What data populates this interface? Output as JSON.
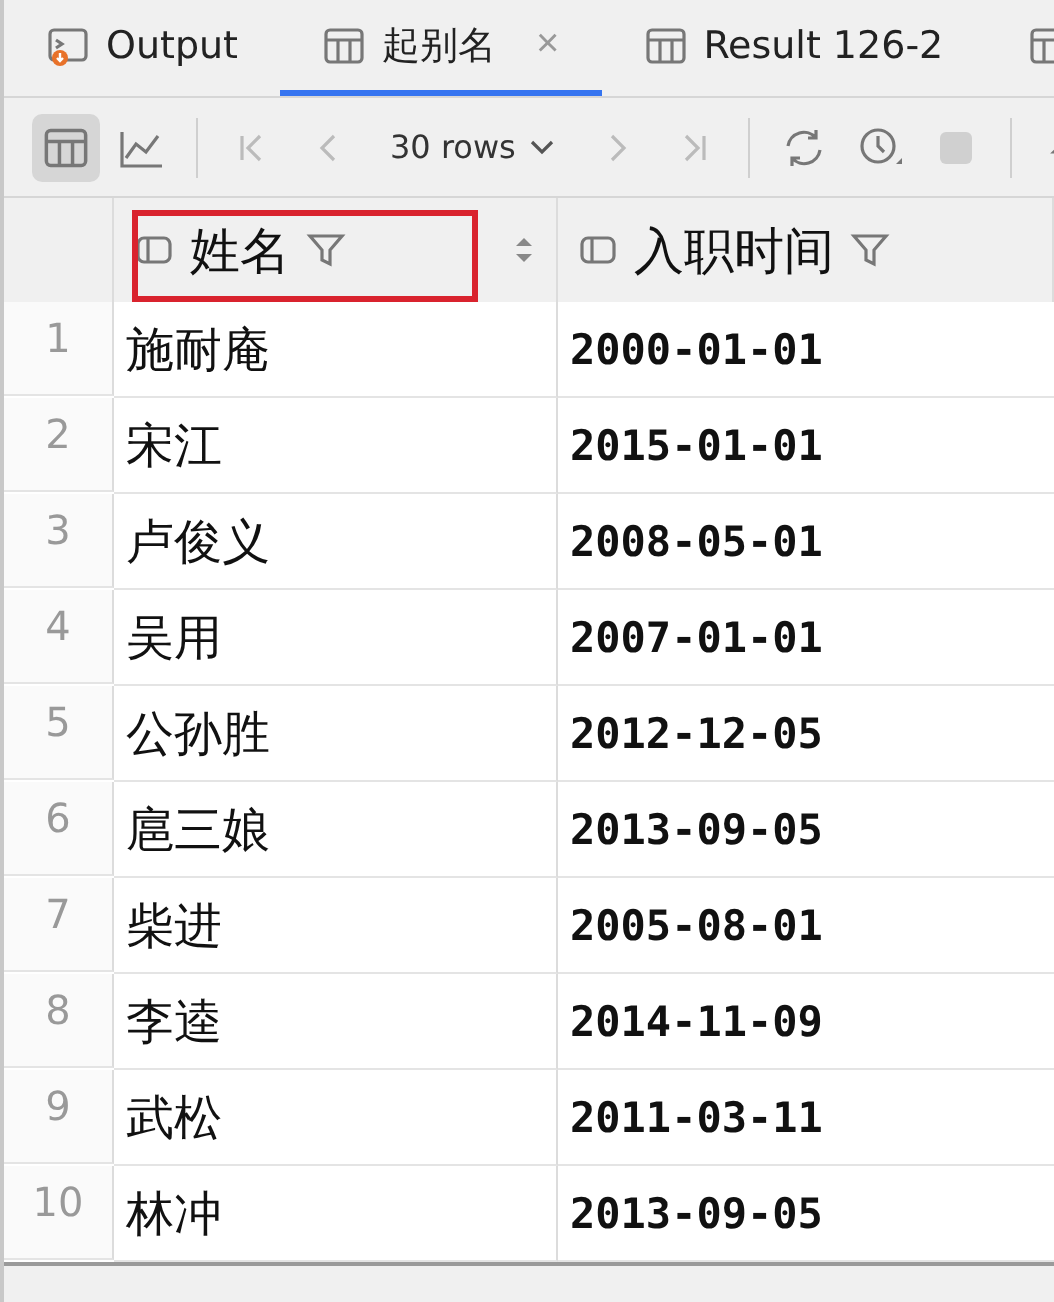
{
  "tabs": [
    {
      "kind": "output",
      "label": "Output",
      "selected": false
    },
    {
      "kind": "table",
      "label": "起别名",
      "selected": true,
      "close": "×"
    },
    {
      "kind": "table",
      "label": "Result 126-2",
      "selected": false
    },
    {
      "kind": "table",
      "selected": false
    }
  ],
  "toolbar": {
    "views": [
      {
        "kind": "table",
        "selected": true
      },
      {
        "kind": "chart",
        "selected": false
      }
    ],
    "page_size": "30 rows"
  },
  "table": {
    "columns": [
      {
        "label": "姓名",
        "highlighted": true,
        "sortable": true
      },
      {
        "label": "入职时间",
        "highlighted": false,
        "sortable": false
      }
    ],
    "rows": [
      {
        "number": "1",
        "cells": [
          "施耐庵",
          "2000-01-01"
        ]
      },
      {
        "number": "2",
        "cells": [
          "宋江",
          "2015-01-01"
        ]
      },
      {
        "number": "3",
        "cells": [
          "卢俊义",
          "2008-05-01"
        ]
      },
      {
        "number": "4",
        "cells": [
          "吴用",
          "2007-01-01"
        ]
      },
      {
        "number": "5",
        "cells": [
          "公孙胜",
          "2012-12-05"
        ]
      },
      {
        "number": "6",
        "cells": [
          "扈三娘",
          "2013-09-05"
        ]
      },
      {
        "number": "7",
        "cells": [
          "柴进",
          "2005-08-01"
        ]
      },
      {
        "number": "8",
        "cells": [
          "李逵",
          "2014-11-09"
        ]
      },
      {
        "number": "9",
        "cells": [
          "武松",
          "2011-03-11"
        ]
      },
      {
        "number": "10",
        "cells": [
          "林冲",
          "2013-09-05"
        ]
      }
    ]
  }
}
